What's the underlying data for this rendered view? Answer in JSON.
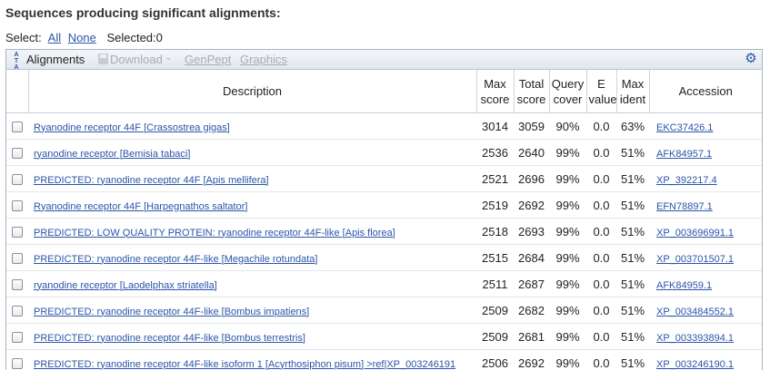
{
  "page_title": "Sequences producing significant alignments:",
  "select_bar": {
    "select_label": "Select:",
    "all_label": "All",
    "none_label": "None",
    "selected_label": "Selected:0"
  },
  "toolbar": {
    "alignments_label": "Alignments",
    "download_label": "Download",
    "genpept_label": "GenPept",
    "graphics_label": "Graphics"
  },
  "columns": {
    "description": "Description",
    "max_score": [
      "Max",
      "score"
    ],
    "total_score": [
      "Total",
      "score"
    ],
    "query_cover": [
      "Query",
      "cover"
    ],
    "e_value": [
      "E",
      "value"
    ],
    "max_ident": [
      "Max",
      "ident"
    ],
    "accession": "Accession"
  },
  "rows": [
    {
      "description": "Ryanodine receptor 44F [Crassostrea gigas]",
      "max_score": "3014",
      "total_score": "3059",
      "query_cover": "90%",
      "e_value": "0.0",
      "max_ident": "63%",
      "accession": "EKC37426.1"
    },
    {
      "description": "ryanodine receptor [Bemisia tabaci]",
      "max_score": "2536",
      "total_score": "2640",
      "query_cover": "99%",
      "e_value": "0.0",
      "max_ident": "51%",
      "accession": "AFK84957.1"
    },
    {
      "description": "PREDICTED: ryanodine receptor 44F [Apis mellifera]",
      "max_score": "2521",
      "total_score": "2696",
      "query_cover": "99%",
      "e_value": "0.0",
      "max_ident": "51%",
      "accession": "XP_392217.4"
    },
    {
      "description": "Ryanodine receptor 44F [Harpegnathos saltator]",
      "max_score": "2519",
      "total_score": "2692",
      "query_cover": "99%",
      "e_value": "0.0",
      "max_ident": "51%",
      "accession": "EFN78897.1"
    },
    {
      "description": "PREDICTED: LOW QUALITY PROTEIN: ryanodine receptor 44F-like [Apis florea]",
      "max_score": "2518",
      "total_score": "2693",
      "query_cover": "99%",
      "e_value": "0.0",
      "max_ident": "51%",
      "accession": "XP_003696991.1"
    },
    {
      "description": "PREDICTED: ryanodine receptor 44F-like [Megachile rotundata]",
      "max_score": "2515",
      "total_score": "2684",
      "query_cover": "99%",
      "e_value": "0.0",
      "max_ident": "51%",
      "accession": "XP_003701507.1"
    },
    {
      "description": "ryanodine receptor [Laodelphax striatella]",
      "max_score": "2511",
      "total_score": "2687",
      "query_cover": "99%",
      "e_value": "0.0",
      "max_ident": "51%",
      "accession": "AFK84959.1"
    },
    {
      "description": "PREDICTED: ryanodine receptor 44F-like [Bombus impatiens]",
      "max_score": "2509",
      "total_score": "2682",
      "query_cover": "99%",
      "e_value": "0.0",
      "max_ident": "51%",
      "accession": "XP_003484552.1"
    },
    {
      "description": "PREDICTED: ryanodine receptor 44F-like [Bombus terrestris]",
      "max_score": "2509",
      "total_score": "2681",
      "query_cover": "99%",
      "e_value": "0.0",
      "max_ident": "51%",
      "accession": "XP_003393894.1"
    },
    {
      "description": "PREDICTED: ryanodine receptor 44F-like isoform 1 [Acyrthosiphon pisum] >ref|XP_003246191",
      "max_score": "2506",
      "total_score": "2692",
      "query_cover": "99%",
      "e_value": "0.0",
      "max_ident": "51%",
      "accession": "XP_003246190.1"
    }
  ]
}
